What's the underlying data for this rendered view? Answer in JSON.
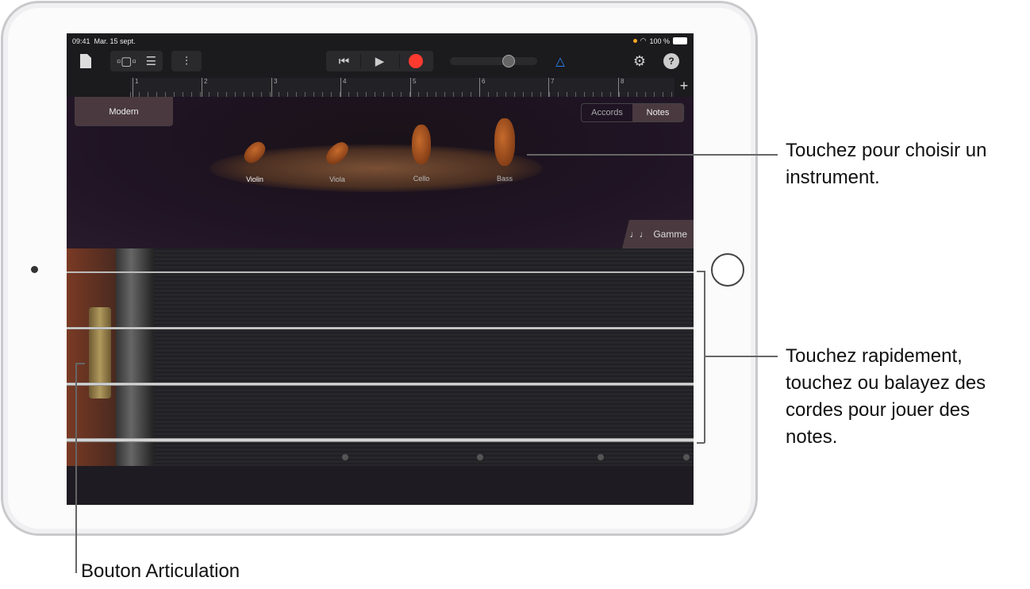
{
  "status": {
    "time": "09:41",
    "date": "Mar. 15 sept.",
    "battery": "100 %"
  },
  "toolbar": {
    "icons": [
      "document-icon",
      "tracks-view-icon",
      "list-view-icon",
      "mixer-icon",
      "rewind-icon",
      "play-icon",
      "record-icon",
      "metronome-icon",
      "settings-icon",
      "help-icon"
    ],
    "help": "?",
    "add": "+"
  },
  "ruler": {
    "bars": [
      "1",
      "2",
      "3",
      "4",
      "5",
      "6",
      "7",
      "8"
    ]
  },
  "preset": "Modern",
  "mode": {
    "chords": "Accords",
    "notes": "Notes",
    "selected": "Notes"
  },
  "instruments": [
    "Violin",
    "Viola",
    "Cello",
    "Bass"
  ],
  "selected_instrument": "Violin",
  "scale_button": "Gamme",
  "scale_icon": "♩♩",
  "callouts": {
    "instrument": "Touchez pour choisir un instrument.",
    "strings": "Touchez rapidement, touchez ou balayez des cordes pour jouer des notes.",
    "articulation": "Bouton Articulation"
  },
  "colors": {
    "record": "#ff3b30",
    "metronome": "#2d8cff",
    "accent_panel": "#4a3a40"
  }
}
